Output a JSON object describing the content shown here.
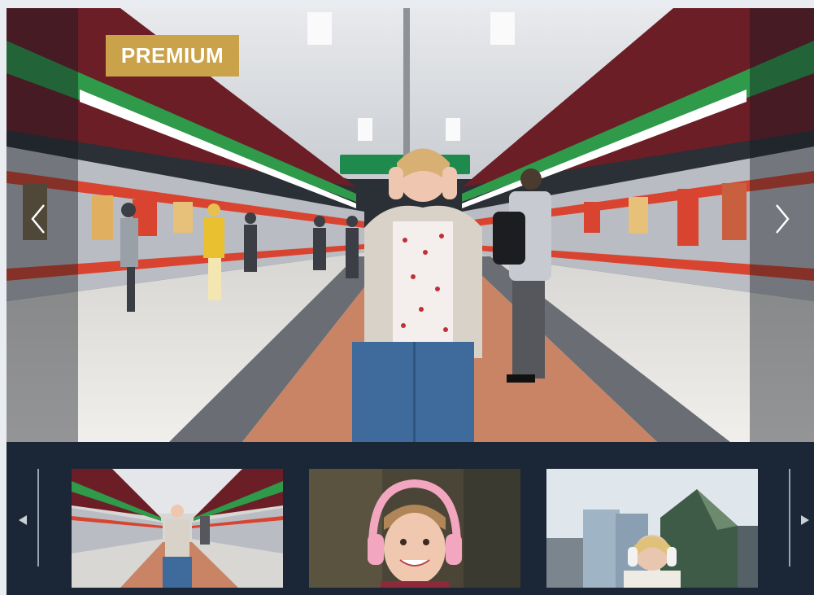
{
  "gallery": {
    "badge": {
      "label": "PREMIUM",
      "color": "#c9a24a"
    },
    "main_image": {
      "alt": "",
      "icon": "photo"
    },
    "nav": {
      "prev_icon": "chevron-left-icon",
      "next_icon": "chevron-right-icon"
    },
    "thumbnails": [
      {
        "icon": "photo",
        "selected": true
      },
      {
        "icon": "photo",
        "selected": false
      },
      {
        "icon": "photo",
        "selected": false
      }
    ],
    "strip_nav": {
      "prev_icon": "triangle-left-icon",
      "next_icon": "triangle-right-icon"
    }
  },
  "colors": {
    "strip_bg": "#1b2636",
    "badge_bg": "#c9a24a",
    "page_bg": "#e9edf1"
  }
}
